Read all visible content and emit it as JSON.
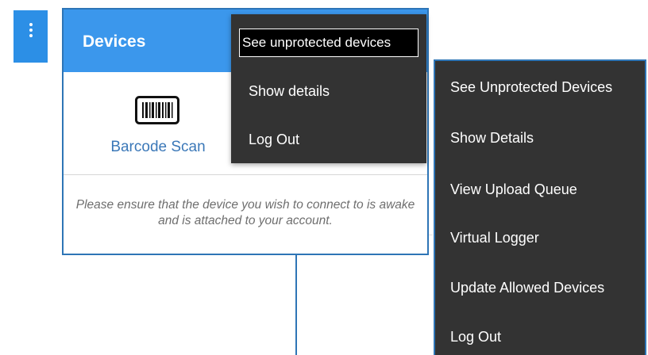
{
  "overflow_button": {
    "icon": "more-vert-icon"
  },
  "card": {
    "title": "Devices",
    "barcode": {
      "icon": "barcode-icon",
      "label": "Barcode Scan"
    },
    "notice": "Please ensure that the device you wish to connect to is awake and is attached to your account."
  },
  "menu_small": {
    "items": [
      {
        "label": "See unprotected devices",
        "highlighted": true
      },
      {
        "label": "Show details"
      },
      {
        "label": "Log Out"
      }
    ]
  },
  "menu_large": {
    "items": [
      {
        "label": "See Unprotected Devices"
      },
      {
        "label": "Show Details"
      },
      {
        "label": "View Upload Queue"
      },
      {
        "label": "Virtual Logger"
      },
      {
        "label": "Update Allowed Devices"
      },
      {
        "label": "Log Out"
      }
    ]
  },
  "colors": {
    "header_blue": "#3b97ec",
    "button_blue": "#2c8fe6",
    "frame_blue": "#2e75b6",
    "menu_bg": "#333333",
    "link_blue": "#3b78b8"
  }
}
